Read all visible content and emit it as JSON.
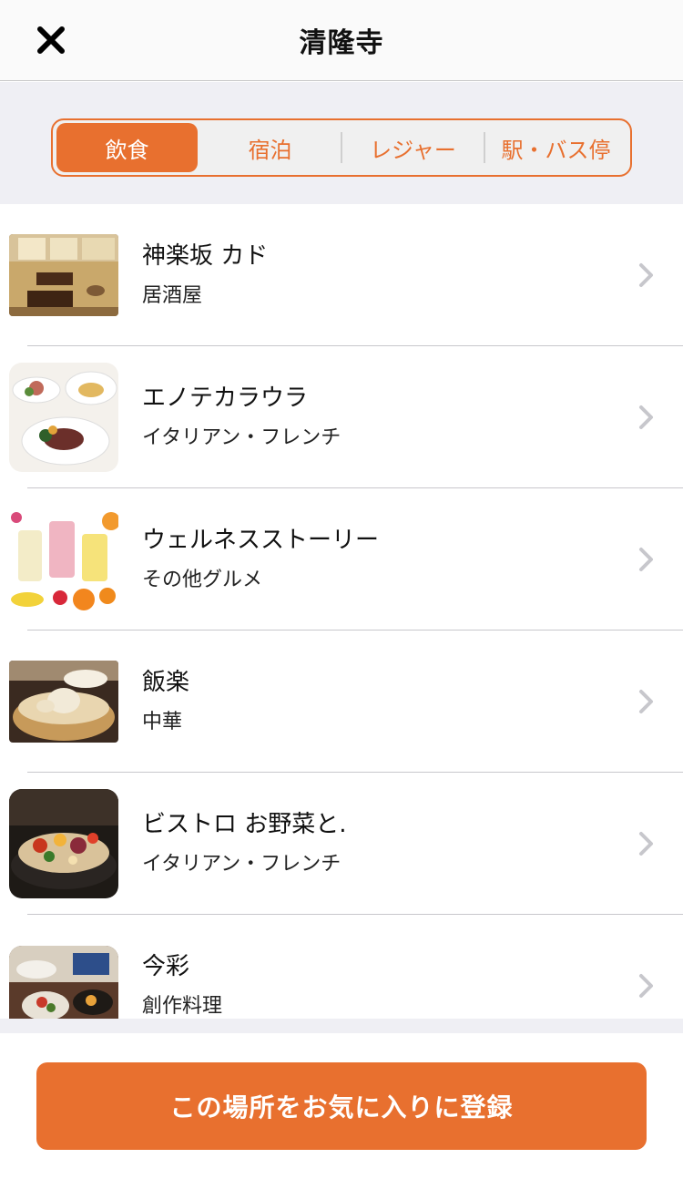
{
  "header": {
    "title": "清隆寺",
    "close_icon": "close-icon"
  },
  "tabs": [
    {
      "label": "飲食",
      "active": true
    },
    {
      "label": "宿泊",
      "active": false
    },
    {
      "label": "レジャー",
      "active": false
    },
    {
      "label": "駅・バス停",
      "active": false
    }
  ],
  "list": [
    {
      "name": "神楽坂 カド",
      "category": "居酒屋",
      "thumb": "japanese-room-photo"
    },
    {
      "name": "エノテカラウラ",
      "category": "イタリアン・フレンチ",
      "thumb": "italian-dish-photo"
    },
    {
      "name": "ウェルネスストーリー",
      "category": "その他グルメ",
      "thumb": "smoothie-photo"
    },
    {
      "name": "飯楽",
      "category": "中華",
      "thumb": "dumpling-photo"
    },
    {
      "name": "ビストロ お野菜と.",
      "category": "イタリアン・フレンチ",
      "thumb": "vegetable-dish-photo"
    },
    {
      "name": "今彩",
      "category": "創作料理",
      "thumb": "japanese-course-photo"
    }
  ],
  "footer": {
    "favorite_button": "この場所をお気に入りに登録"
  },
  "colors": {
    "accent": "#e8702f",
    "background": "#efeff4"
  }
}
